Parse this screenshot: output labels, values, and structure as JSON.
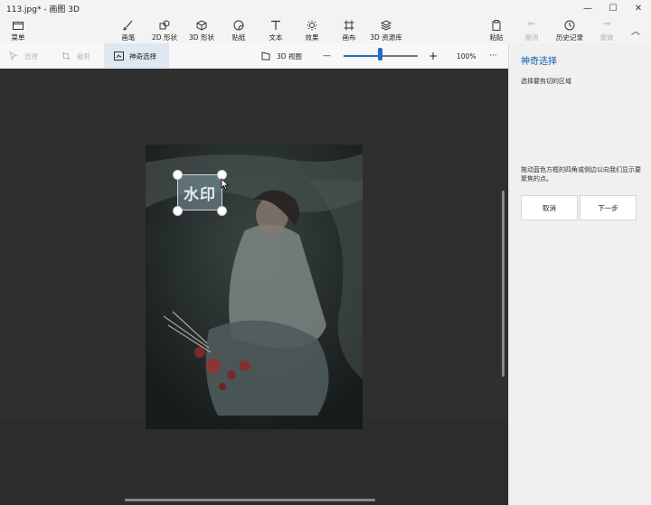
{
  "window": {
    "title": "113.jpg* - 画图 3D",
    "minimize": "—",
    "maximize": "☐",
    "close": "✕"
  },
  "toolbar": {
    "menu": "菜单",
    "brush": "画笔",
    "shapes2d": "2D 形状",
    "shapes3d": "3D 形状",
    "stickers": "贴纸",
    "text": "文本",
    "effects": "效果",
    "canvas": "画布",
    "library3d": "3D 资源库",
    "paste": "粘贴",
    "undo": "撤消",
    "history": "历史记录",
    "redo": "重做",
    "collapse": "︿"
  },
  "subbar": {
    "select": "选择",
    "crop": "裁剪",
    "magic_select": "神奇选择",
    "view3d": "3D 视图",
    "zoom_minus": "—",
    "zoom_plus": "+",
    "zoom_value": "100%",
    "zoom_fraction": 0.49,
    "more": "···"
  },
  "canvas": {
    "watermark_text": "水印"
  },
  "panel": {
    "title": "神奇选择",
    "description": "选择要剪切的区域",
    "hint": "拖动蓝色方框的四角或侧边以向我们显示要聚焦的点。",
    "cancel": "取消",
    "next": "下一步"
  },
  "colors": {
    "accent": "#1f6fc5",
    "panel_title": "#0f5fae"
  }
}
